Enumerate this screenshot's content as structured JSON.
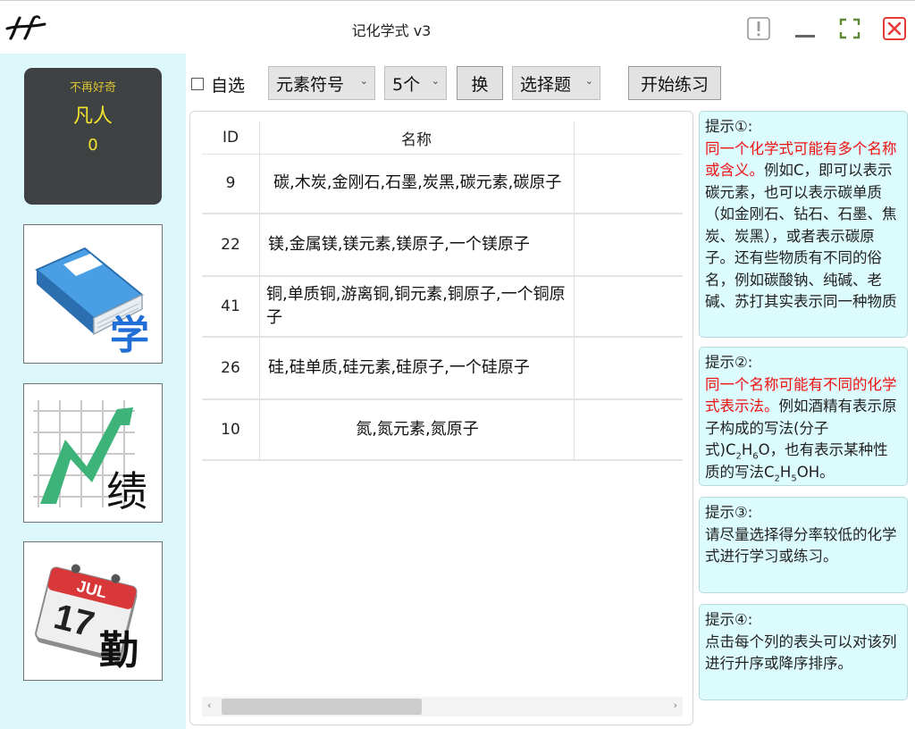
{
  "window": {
    "title": "记化学式 v3"
  },
  "user": {
    "subtitle": "不再好奇",
    "rank": "凡人",
    "score": "0"
  },
  "nav": [
    {
      "label": "学",
      "icon": "book-icon"
    },
    {
      "label": "绩",
      "icon": "chart-icon"
    },
    {
      "label": "勤",
      "icon": "calendar-icon",
      "calendar_month": "JUL",
      "calendar_day": "17"
    }
  ],
  "toolbar": {
    "self_select_label": "自选",
    "self_select_checked": false,
    "mode_value": "元素符号",
    "count_value": "5个",
    "swap_label": "换",
    "type_value": "选择题",
    "start_label": "开始练习"
  },
  "table": {
    "columns": [
      "ID",
      "名称"
    ],
    "rows": [
      {
        "id": "9",
        "name": "碳,木炭,金刚石,石墨,炭黑,碳元素,碳原子"
      },
      {
        "id": "22",
        "name": "镁,金属镁,镁元素,镁原子,一个镁原子"
      },
      {
        "id": "41",
        "name": "铜,单质铜,游离铜,铜元素,铜原子,一个铜原子"
      },
      {
        "id": "26",
        "name": "硅,硅单质,硅元素,硅原子,一个硅原子"
      },
      {
        "id": "10",
        "name": "氮,氮元素,氮原子"
      }
    ]
  },
  "hints": [
    {
      "title": "提示①:",
      "highlight": "同一个化学式可能有多个名称或含义。",
      "body": "例如C，即可以表示碳元素，也可以表示碳单质（如金刚石、钻石、石墨、焦炭、炭黑），或者表示碳原子。还有些物质有不同的俗名，例如碳酸钠、纯碱、老碱、苏打其实表示同一种物质"
    },
    {
      "title": "提示②:",
      "highlight": "同一个名称可能有不同的化学式表示法。",
      "body_pre": "例如酒精有表示原子构成的写法(分子式)",
      "formula1": "C2H6O",
      "body_mid": "，也有表示某种性质的写法",
      "formula2": "C2H5OH",
      "body_post": "。"
    },
    {
      "title": "提示③:",
      "highlight": "",
      "body": "请尽量选择得分率较低的化学式进行学习或练习。"
    },
    {
      "title": "提示④:",
      "highlight": "",
      "body": "点击每个列的表头可以对该列进行升序或降序排序。"
    }
  ],
  "colors": {
    "sidebar_bg": "#ddf8fb",
    "hint_bg": "#dcfbfd",
    "highlight_red": "#ee1111",
    "user_yellow": "#f4e52c",
    "user_box_bg": "#3f4243"
  }
}
